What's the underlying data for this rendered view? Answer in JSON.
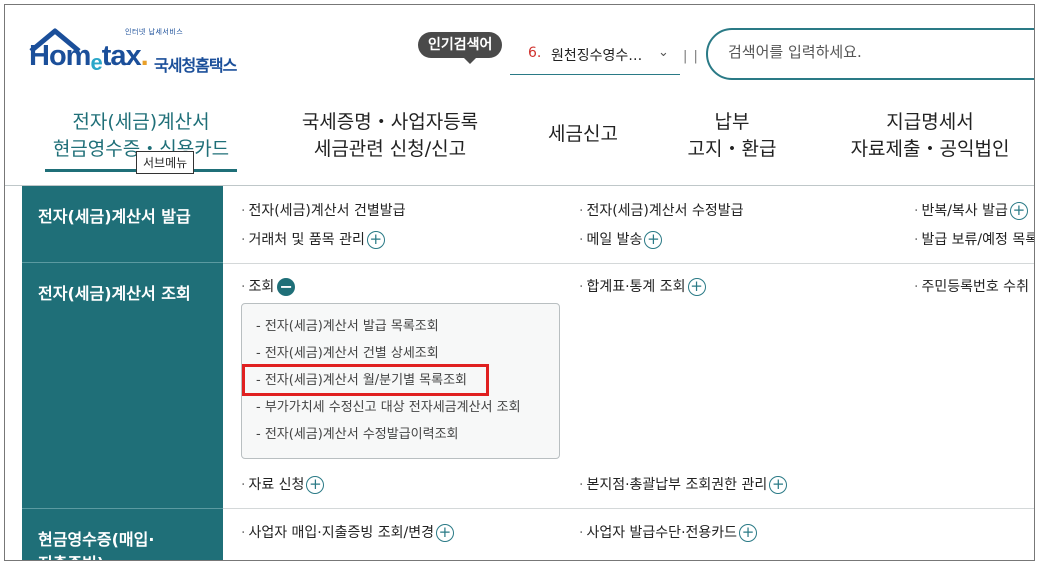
{
  "header": {
    "logo": {
      "tagline": "인터넷 납세서비스",
      "brand_main": "Hom",
      "brand_e": "e",
      "brand_rest": "tax",
      "brand_dot": ".",
      "korean_name": "국세청홈택스"
    },
    "popular_badge": "인기검색어",
    "popular_rank": {
      "number": "6.",
      "text": "원천징수영수…"
    },
    "search": {
      "placeholder": "검색어를 입력하세요."
    }
  },
  "nav": {
    "tabs": [
      {
        "line1": "전자(세금)계산서",
        "line2": "현금영수증・신용카드"
      },
      {
        "line1": "국세증명・사업자등록",
        "line2": "세금관련 신청/신고"
      },
      {
        "line1": "세금신고",
        "line2": ""
      },
      {
        "line1": "납부",
        "line2": "고지・환급"
      },
      {
        "line1": "지급명세서",
        "line2": "자료제출・공익법인"
      }
    ],
    "tooltip": "서브메뉴"
  },
  "sidebar": {
    "items": [
      {
        "label": "전자(세금)계산서 발급"
      },
      {
        "label": "전자(세금)계산서 조회"
      },
      {
        "label": "현금영수증(매입·",
        "label2": "지출증빙)"
      }
    ]
  },
  "rows": {
    "issue": {
      "col1": [
        "전자(세금)계산서 건별발급",
        "거래처 및 품목 관리"
      ],
      "col2": [
        "전자(세금)계산서 수정발급",
        "메일 발송"
      ],
      "col3": [
        "반복/복사 발급",
        "발급 보류/예정 목록"
      ]
    },
    "inquiry": {
      "col1_head": "조회",
      "col2_head": "합계표·통계 조회",
      "col3_head": "주민등록번호 수취",
      "submenu": [
        "전자(세금)계산서 발급 목록조회",
        "전자(세금)계산서 건별 상세조회",
        "전자(세금)계산서 월/분기별 목록조회",
        "부가가치세 수정신고 대상 전자세금계산서 조회",
        "전자(세금)계산서 수정발급이력조회"
      ],
      "col1_bottom": "자료 신청",
      "col2_bottom": "본지점·총괄납부 조회권한 관리"
    },
    "cash": {
      "col1": "사업자 매입·지출증빙 조회/변경",
      "col2": "사업자 발급수단·전용카드"
    }
  },
  "colors": {
    "accent": "#1f6f78",
    "highlight": "#e02020",
    "brand": "#1b4f9a"
  }
}
